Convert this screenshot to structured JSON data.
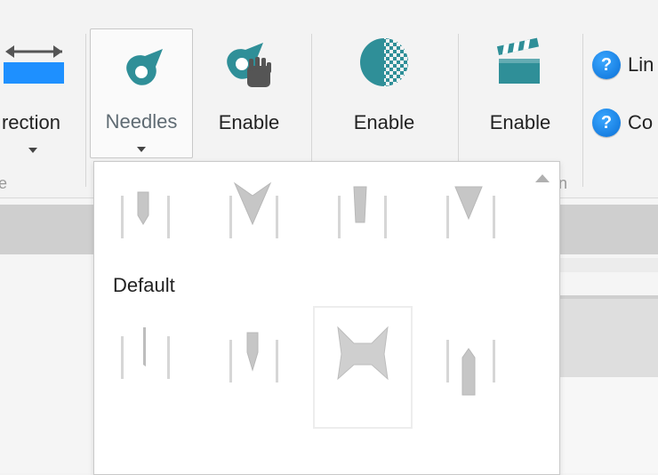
{
  "ribbon": {
    "direction_label": "rection",
    "needles_label": "Needles",
    "enable_labels": [
      "Enable",
      "Enable",
      "Enable"
    ],
    "side_items": [
      "Lin",
      "Co"
    ],
    "group_label_left": "e",
    "group_label_right": "n"
  },
  "dropdown": {
    "section_title": "Default",
    "row1": [
      "needle-narrow",
      "needle-v-wide",
      "needle-slim-taper",
      "needle-v-narrow"
    ],
    "row2": [
      "needle-thin",
      "needle-point",
      "needle-bowtie",
      "needle-pin"
    ],
    "selected": "needle-bowtie"
  },
  "colors": {
    "accent_teal": "#2f8f98",
    "accent_blue": "#1e90ff",
    "help_blue": "#0a6fd6",
    "needle_gray": "#c8c8c8"
  }
}
